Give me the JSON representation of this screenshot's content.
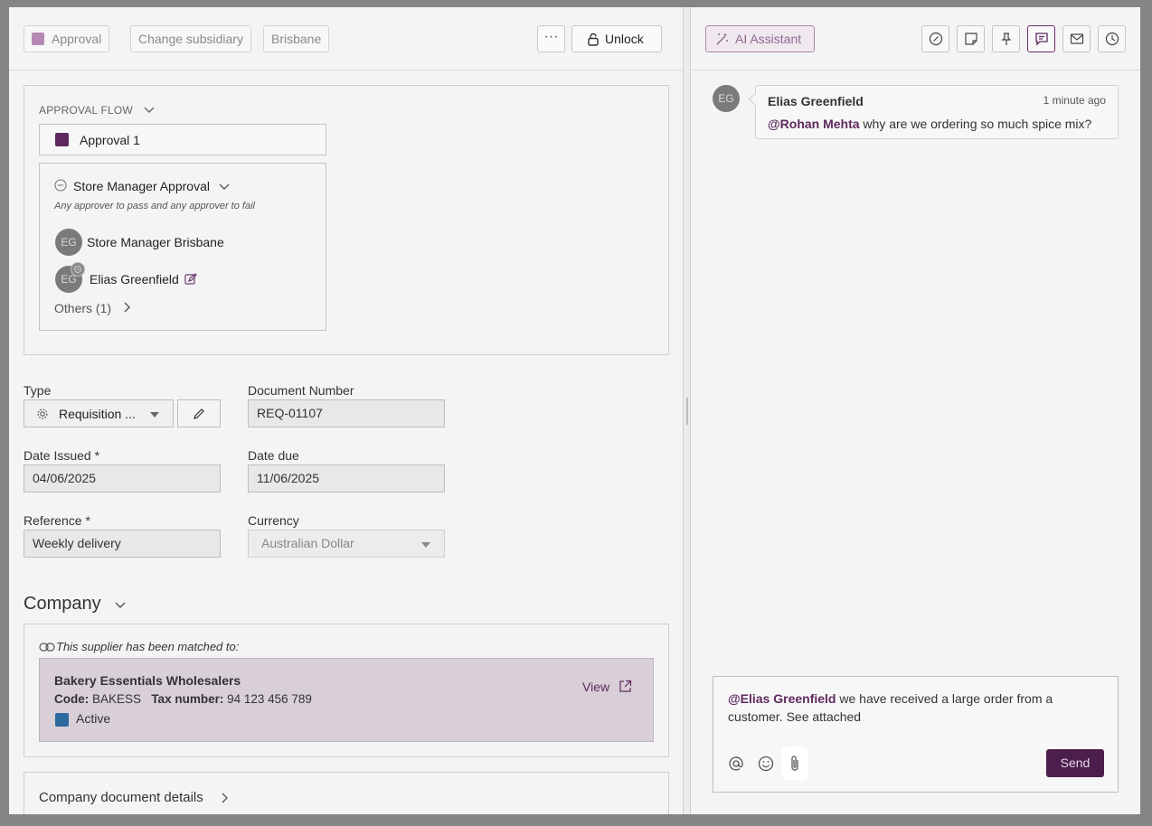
{
  "left_header": {
    "chips": [
      "Approval",
      "Change subsidiary",
      "Brisbane"
    ],
    "more_label": "···",
    "unlock_label": "Unlock"
  },
  "approval_flow": {
    "title": "APPROVAL FLOW",
    "stage_label": "Approval 1",
    "step_title": "Store Manager Approval",
    "step_rule": "Any approver to pass and any approver to fail",
    "approvers": [
      {
        "initials": "EG",
        "name": "Store Manager Brisbane"
      },
      {
        "initials": "EG",
        "name": "Elias Greenfield"
      }
    ],
    "others_label": "Others (1)"
  },
  "form": {
    "type_label": "Type",
    "type_value": "Requisition ...",
    "doc_number_label": "Document Number",
    "doc_number_value": "REQ-01107",
    "date_issued_label": "Date Issued *",
    "date_issued_value": "04/06/2025",
    "date_due_label": "Date due",
    "date_due_value": "11/06/2025",
    "reference_label": "Reference *",
    "reference_value": "Weekly delivery",
    "currency_label": "Currency",
    "currency_value": "Australian Dollar"
  },
  "company": {
    "heading": "Company",
    "matched_text": "This supplier has been matched to:",
    "supplier_name": "Bakery Essentials Wholesalers",
    "code_label": "Code:",
    "code_value": "BAKESS",
    "tax_label": "Tax number:",
    "tax_value": "94 123 456 789",
    "status": "Active",
    "view_label": "View",
    "doc_details_label": "Company document details"
  },
  "right_header": {
    "ai_label": "AI Assistant"
  },
  "comments": [
    {
      "initials": "EG",
      "author": "Elias Greenfield",
      "time": "1 minute ago",
      "mention": "@Rohan Mehta",
      "text": " why are we ordering so much spice mix?"
    }
  ],
  "composer": {
    "mention": "@Elias Greenfield",
    "text": " we have received a large order from a customer. See attached",
    "send_label": "Send"
  },
  "colors": {
    "accent": "#5e2a5e",
    "status_active": "#2d6aa0"
  }
}
